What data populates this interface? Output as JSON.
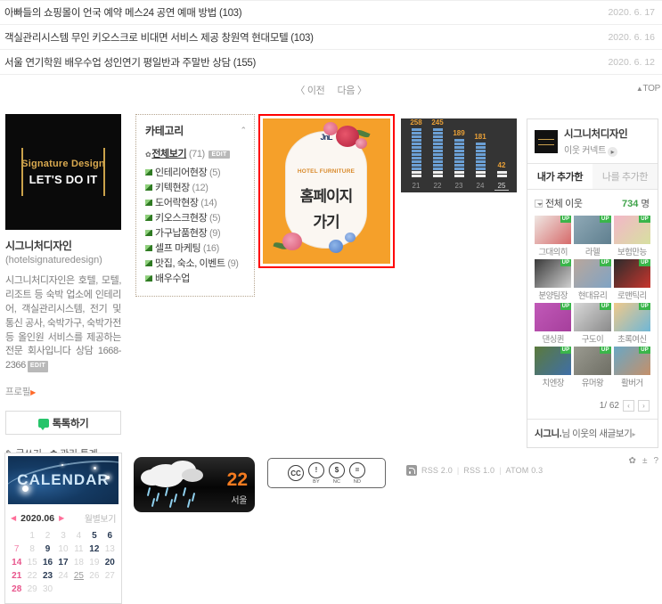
{
  "posts": [
    {
      "title": "아빠들의 쇼핑몰이 언국 예약 메스24 공연 예매 방법 (103)",
      "date": "2020. 6. 17"
    },
    {
      "title": "객실관리시스템 무인 키오스크로 비대면 서비스 제공 창원역 현대모텔 (103)",
      "date": "2020. 6. 16"
    },
    {
      "title": "서울 연기학원 배우수업 성인연기 평일반과 주말반 상담 (155)",
      "date": "2020. 6. 12"
    }
  ],
  "pager": {
    "prev": "〈 이전",
    "next": "다음 〉",
    "top": "TOP",
    "top_arrow": "▲"
  },
  "profile": {
    "image_line1": "Signature Design",
    "image_line2": "LET'S DO IT",
    "blog_name": "시그니처디자인",
    "blog_id": "(hotelsignaturedesign)",
    "description": "시그니처디자인은 호텔, 모텔, 리조트 등 숙박 업소에 인테리어, 객실관리시스템, 전기 및 통신 공사, 숙박가구, 숙박가전 등 올인원 서비스를 제공하는 전문 회사입니다 상담 1668-2366",
    "edit_badge": "EDIT",
    "profile_link": "프로필",
    "profile_link_arrow": "▶",
    "talk_button": "톡톡하기",
    "write_label": "글쓰기",
    "admin_label": "관리·통계",
    "pen_icon": "✎",
    "gear_icon": "✿"
  },
  "category": {
    "title": "카테고리",
    "collapse_icon": "⌃",
    "all_label": "전체보기",
    "all_count": "(71)",
    "all_edit": "EDIT",
    "bullet": "✿",
    "items": [
      {
        "label": "인테리어현장",
        "count": "(5)"
      },
      {
        "label": "키텍현장",
        "count": "(12)"
      },
      {
        "label": "도어락현장",
        "count": "(14)"
      },
      {
        "label": "키오스크현장",
        "count": "(5)"
      },
      {
        "label": "가구납품현장",
        "count": "(9)"
      },
      {
        "label": "셀프 마케팅",
        "count": "(16)"
      },
      {
        "label": "맛집, 숙소, 이벤트",
        "count": "(9)"
      },
      {
        "label": "배우수업",
        "count": ""
      }
    ]
  },
  "banner": {
    "brand": "HOTEL FURNITURE",
    "brand_mark": "JnL",
    "line1": "홈페이지",
    "line2": "가기",
    "border_color": "#ff0000",
    "background_color": "#f5a02a"
  },
  "chart_data": {
    "type": "bar",
    "title": "",
    "categories": [
      "21",
      "22",
      "23",
      "24",
      "25"
    ],
    "values": [
      258,
      245,
      189,
      181,
      42
    ],
    "xlabel": "",
    "ylabel": "",
    "ylim": [
      0,
      270
    ],
    "bar_color": "#6b9fd4",
    "label_color": "#e9a037",
    "background": "#343434",
    "current_index": 4
  },
  "neighbors": {
    "owner_name": "시그니처디자인",
    "connect_label": "이웃 커넥트",
    "connect_icon": "▸",
    "tabs": [
      {
        "label": "내가 추가한",
        "active": true
      },
      {
        "label": "나를 추가한",
        "active": false
      }
    ],
    "all_label": "전체 이웃",
    "count": "734",
    "count_unit": "명",
    "items": [
      {
        "name": "그대의히",
        "badge": "UP",
        "color1": "#efe7e3",
        "color2": "#d66a6a"
      },
      {
        "name": "라헬",
        "badge": "UP",
        "color1": "#8fa9b6",
        "color2": "#5f7f8f"
      },
      {
        "name": "보험만능",
        "badge": "UP",
        "color1": "#f3b6c8",
        "color2": "#d7e0a0"
      },
      {
        "name": "분양팀장",
        "badge": "UP",
        "color1": "#3a3a3a",
        "color2": "#cfcfcf"
      },
      {
        "name": "현대유리",
        "badge": "UP",
        "color1": "#b9a79c",
        "color2": "#7fa3c4"
      },
      {
        "name": "로맨틱리",
        "badge": "UP",
        "color1": "#2b2b2b",
        "color2": "#c8362e"
      },
      {
        "name": "댄싱퀸",
        "badge": "UP",
        "color1": "#c159b8",
        "color2": "#a63f9c"
      },
      {
        "name": "구도이",
        "badge": "UP",
        "color1": "#d8d8d8",
        "color2": "#8a8a8a"
      },
      {
        "name": "초록여신",
        "badge": "UP",
        "color1": "#f0c98a",
        "color2": "#6fb7d6"
      },
      {
        "name": "치엔장",
        "badge": "UP",
        "color1": "#5b7a3c",
        "color2": "#3f6fa8"
      },
      {
        "name": "유머왕",
        "badge": "UP",
        "color1": "#9a9a90",
        "color2": "#6e6e64"
      },
      {
        "name": "활버거",
        "badge": "UP",
        "color1": "#6aa7c4",
        "color2": "#c4906a"
      }
    ],
    "page": "1/ 62",
    "prev_icon": "‹",
    "next_icon": "›",
    "footer_owner": "시그니.",
    "footer_text": "님 이웃의 새글보기",
    "footer_arrow": "▸",
    "tool_icons": [
      "✿",
      "±",
      "?"
    ]
  },
  "calendar": {
    "banner_text": "CALENDAR",
    "prev_icon": "◀",
    "next_icon": "▶",
    "year_month": "2020.06",
    "view_label": "월별보기",
    "weeks": [
      [
        {
          "d": "",
          "t": ""
        },
        {
          "d": "1",
          "t": ""
        },
        {
          "d": "2",
          "t": ""
        },
        {
          "d": "3",
          "t": ""
        },
        {
          "d": "4",
          "t": ""
        },
        {
          "d": "5",
          "t": "has"
        },
        {
          "d": "6",
          "t": "has"
        }
      ],
      [
        {
          "d": "7",
          "t": "sun"
        },
        {
          "d": "8",
          "t": ""
        },
        {
          "d": "9",
          "t": "has"
        },
        {
          "d": "10",
          "t": ""
        },
        {
          "d": "11",
          "t": ""
        },
        {
          "d": "12",
          "t": "has"
        },
        {
          "d": "13",
          "t": ""
        }
      ],
      [
        {
          "d": "14",
          "t": "sun has"
        },
        {
          "d": "15",
          "t": ""
        },
        {
          "d": "16",
          "t": "has"
        },
        {
          "d": "17",
          "t": "has"
        },
        {
          "d": "18",
          "t": ""
        },
        {
          "d": "19",
          "t": ""
        },
        {
          "d": "20",
          "t": "has"
        }
      ],
      [
        {
          "d": "21",
          "t": "sun has"
        },
        {
          "d": "22",
          "t": ""
        },
        {
          "d": "23",
          "t": "has"
        },
        {
          "d": "24",
          "t": ""
        },
        {
          "d": "25",
          "t": "today"
        },
        {
          "d": "26",
          "t": ""
        },
        {
          "d": "27",
          "t": ""
        }
      ],
      [
        {
          "d": "28",
          "t": "sun has"
        },
        {
          "d": "29",
          "t": ""
        },
        {
          "d": "30",
          "t": ""
        },
        {
          "d": "",
          "t": ""
        },
        {
          "d": "",
          "t": ""
        },
        {
          "d": "",
          "t": ""
        },
        {
          "d": "",
          "t": ""
        }
      ]
    ]
  },
  "weather": {
    "temperature": "22",
    "city": "서울",
    "condition": "rain",
    "temp_color": "#f47b20"
  },
  "cc_license": {
    "main": "CC",
    "items": [
      {
        "glyph": "!",
        "label": "BY"
      },
      {
        "glyph": "$",
        "label": "NC"
      },
      {
        "glyph": "=",
        "label": "ND"
      }
    ]
  },
  "rss": {
    "links": [
      "RSS 2.0",
      "RSS 1.0",
      "ATOM 0.3"
    ],
    "separator": "|"
  }
}
